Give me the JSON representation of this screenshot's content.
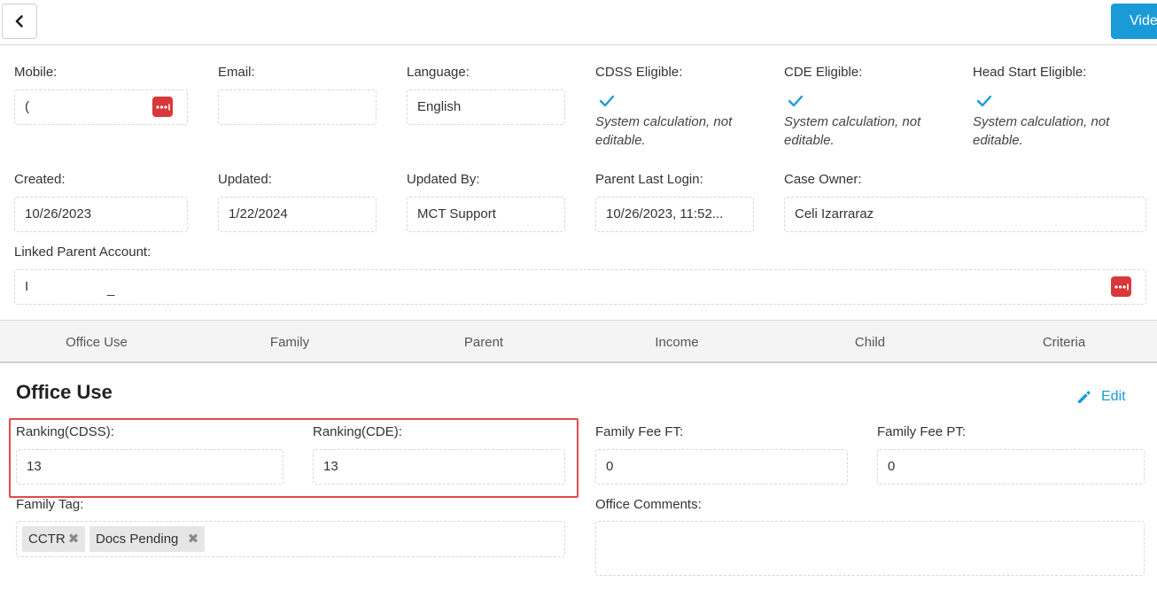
{
  "topbar": {
    "back_icon": "chevron-left-icon",
    "video_label": "Video"
  },
  "contact": {
    "mobile": {
      "label": "Mobile:",
      "value": "("
    },
    "email": {
      "label": "Email:",
      "value": ""
    },
    "language": {
      "label": "Language:",
      "value": "English"
    },
    "cdss": {
      "label": "CDSS Eligible:",
      "checked": true,
      "note": "System calculation, not editable."
    },
    "cde": {
      "label": "CDE Eligible:",
      "checked": true,
      "note": "System calculation, not editable."
    },
    "head_start": {
      "label": "Head Start Eligible:",
      "checked": true,
      "note": "System calculation, not editable."
    }
  },
  "meta": {
    "created": {
      "label": "Created:",
      "value": "10/26/2023"
    },
    "updated": {
      "label": "Updated:",
      "value": "1/22/2024"
    },
    "updated_by": {
      "label": "Updated By:",
      "value": "MCT Support"
    },
    "parent_last_login": {
      "label": "Parent Last Login:",
      "value": "10/26/2023, 11:52..."
    },
    "case_owner": {
      "label": "Case Owner:",
      "value": "Celi Izarraraz"
    }
  },
  "linked_parent": {
    "label": "Linked Parent Account:",
    "value": "I",
    "value_suffix": "_"
  },
  "tabs": [
    "Office Use",
    "Family",
    "Parent",
    "Income",
    "Child",
    "Criteria"
  ],
  "office_use": {
    "title": "Office Use",
    "edit_label": "Edit",
    "ranking_cdss": {
      "label": "Ranking(CDSS):",
      "value": "13"
    },
    "ranking_cde": {
      "label": "Ranking(CDE):",
      "value": "13"
    },
    "family_fee_ft": {
      "label": "Family Fee FT:",
      "value": "0"
    },
    "family_fee_pt": {
      "label": "Family Fee PT:",
      "value": "0"
    },
    "family_tag": {
      "label": "Family Tag:",
      "tags": [
        "CCTR",
        "Docs Pending"
      ]
    },
    "office_comments": {
      "label": "Office Comments:",
      "value": ""
    }
  },
  "colors": {
    "accent": "#1a9bd7",
    "danger": "#d9383a",
    "highlight": "#e04a4a"
  }
}
